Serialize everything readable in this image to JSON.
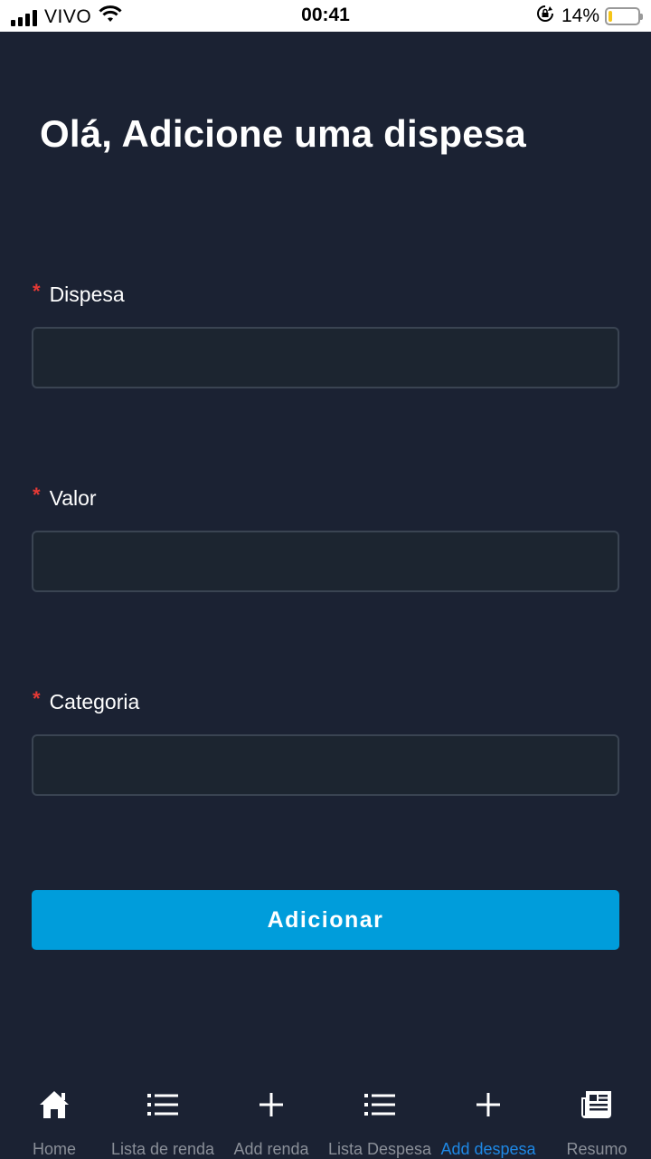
{
  "status_bar": {
    "carrier": "VIVO",
    "time": "00:41",
    "battery_percent": "14%",
    "battery_level": 0.14
  },
  "page": {
    "title": "Olá, Adicione uma dispesa"
  },
  "form": {
    "fields": [
      {
        "label": "Dispesa",
        "value": "",
        "required_mark": "*"
      },
      {
        "label": "Valor",
        "value": "",
        "required_mark": "*"
      },
      {
        "label": "Categoria",
        "value": "",
        "required_mark": "*"
      }
    ],
    "submit_label": "Adicionar"
  },
  "tabs": [
    {
      "label": "Home",
      "icon": "home-icon"
    },
    {
      "label": "Lista de renda",
      "icon": "list-icon"
    },
    {
      "label": "Add renda",
      "icon": "plus-icon"
    },
    {
      "label": "Lista Despesa",
      "icon": "list-icon"
    },
    {
      "label": "Add despesa",
      "icon": "plus-icon",
      "active": true
    },
    {
      "label": "Resumo",
      "icon": "newspaper-icon"
    }
  ],
  "colors": {
    "background": "#1b2233",
    "accent": "#009ddb",
    "active_tab": "#1e88e5",
    "required": "#e53935"
  }
}
